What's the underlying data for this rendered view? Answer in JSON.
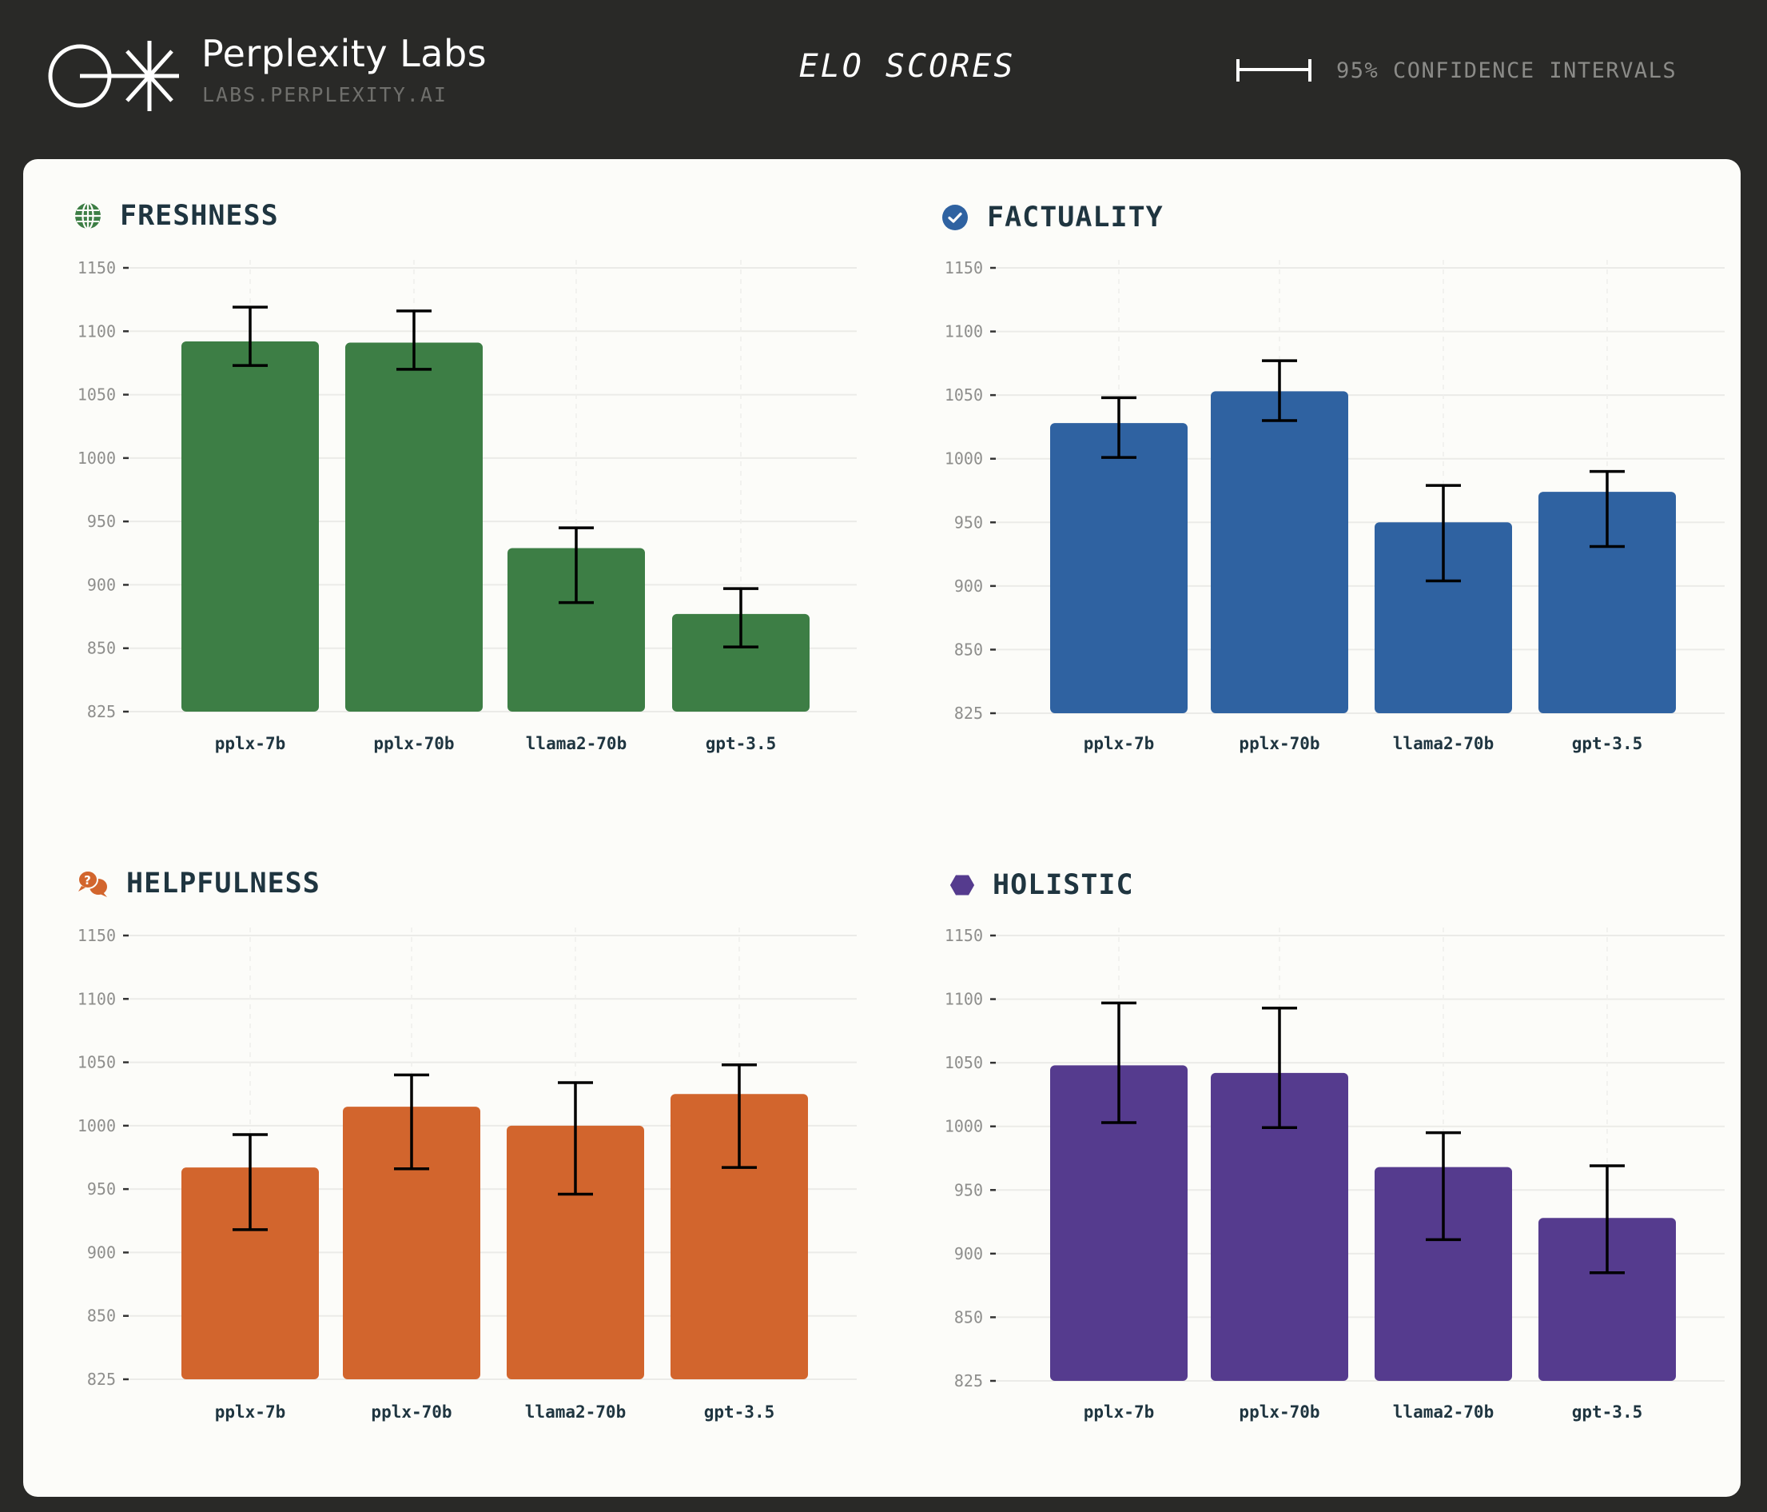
{
  "header": {
    "brand_title": "Perplexity Labs",
    "brand_subtitle": "LABS.PERPLEXITY.AI",
    "logo_icon": "perplexity-logo-icon",
    "heading": "ELO SCORES",
    "legend_icon": "error-bar-icon",
    "legend_text": "95% CONFIDENCE INTERVALS"
  },
  "colors": {
    "background": "#292927",
    "card": "#fcfcf9",
    "freshness": "#3d7e45",
    "factuality": "#2f62a1",
    "helpfulness": "#d2652d",
    "holistic": "#553b8e",
    "title_text": "#1f3540",
    "error_bar": "#000000"
  },
  "chart_data": [
    {
      "type": "bar",
      "title": "FRESHNESS",
      "icon": "globe-icon",
      "color_key": "freshness",
      "categories": [
        "pplx-7b",
        "pplx-70b",
        "llama2-70b",
        "gpt-3.5"
      ],
      "values": [
        1092,
        1091,
        929,
        877
      ],
      "ci_low": [
        1073,
        1070,
        886,
        851
      ],
      "ci_high": [
        1119,
        1116,
        945,
        897
      ],
      "yticks": [
        1150,
        1100,
        1050,
        1000,
        950,
        900,
        850,
        825
      ],
      "ylim": [
        825,
        1150
      ],
      "xlabel": "",
      "ylabel": "",
      "grid": true,
      "legend": "top-right"
    },
    {
      "type": "bar",
      "title": "FACTUALITY",
      "icon": "check-circle-icon",
      "color_key": "factuality",
      "categories": [
        "pplx-7b",
        "pplx-70b",
        "llama2-70b",
        "gpt-3.5"
      ],
      "values": [
        1028,
        1053,
        950,
        974
      ],
      "ci_low": [
        1001,
        1030,
        904,
        931
      ],
      "ci_high": [
        1048,
        1077,
        979,
        990
      ],
      "yticks": [
        1150,
        1100,
        1050,
        1000,
        950,
        900,
        850,
        825
      ],
      "ylim": [
        825,
        1150
      ],
      "xlabel": "",
      "ylabel": "",
      "grid": true,
      "legend": "top-right"
    },
    {
      "type": "bar",
      "title": "HELPFULNESS",
      "icon": "chat-question-icon",
      "color_key": "helpfulness",
      "categories": [
        "pplx-7b",
        "pplx-70b",
        "llama2-70b",
        "gpt-3.5"
      ],
      "values": [
        967,
        1015,
        1000,
        1025
      ],
      "ci_low": [
        918,
        966,
        946,
        967
      ],
      "ci_high": [
        993,
        1040,
        1034,
        1048
      ],
      "yticks": [
        1150,
        1100,
        1050,
        1000,
        950,
        900,
        850,
        825
      ],
      "ylim": [
        825,
        1150
      ],
      "xlabel": "",
      "ylabel": "",
      "grid": true,
      "legend": "top-right"
    },
    {
      "type": "bar",
      "title": "HOLISTIC",
      "icon": "hexagon-icon",
      "color_key": "holistic",
      "categories": [
        "pplx-7b",
        "pplx-70b",
        "llama2-70b",
        "gpt-3.5"
      ],
      "values": [
        1048,
        1042,
        968,
        928
      ],
      "ci_low": [
        1003,
        999,
        911,
        885
      ],
      "ci_high": [
        1097,
        1093,
        995,
        969
      ],
      "yticks": [
        1150,
        1100,
        1050,
        1000,
        950,
        900,
        850,
        825
      ],
      "ylim": [
        825,
        1150
      ],
      "xlabel": "",
      "ylabel": "",
      "grid": true,
      "legend": "top-right"
    }
  ]
}
